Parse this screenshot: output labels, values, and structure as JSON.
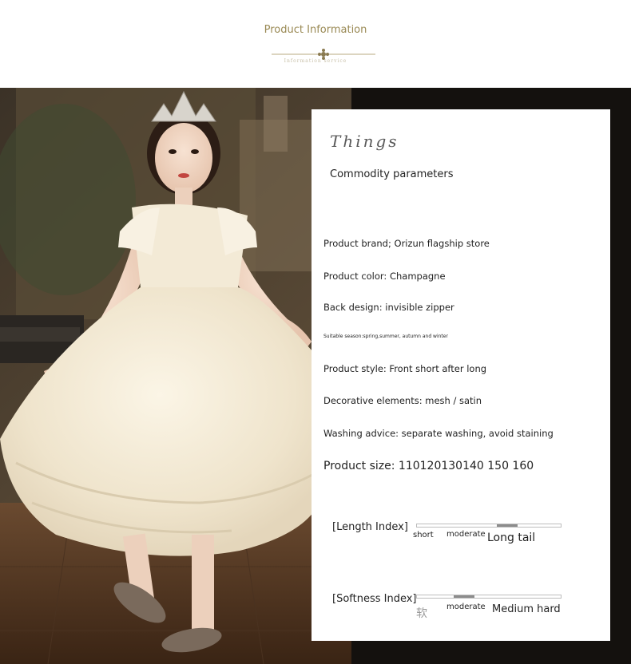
{
  "header": {
    "title": "Product Information",
    "ornament_text": "Information service"
  },
  "panel": {
    "title": "Things",
    "subtitle": "Commodity parameters",
    "params": [
      "Product brand; Orizun flagship store",
      "Product color: Champagne",
      "Back design: invisible zipper",
      "Suitable season:spring,summer, autumn and winter",
      "Product style: Front short after long",
      "Decorative elements: mesh / satin",
      "Washing advice: separate washing, avoid staining",
      "Product size: 110120130140 150 160"
    ],
    "length_index": {
      "label": "[Length Index]",
      "low": "short",
      "mid": "moderate",
      "high": "Long tail",
      "level": 0.63
    },
    "softness_index": {
      "label": "[Softness Index]",
      "low": "软",
      "mid": "moderate",
      "high": "Medium hard",
      "level": 0.33
    }
  },
  "colors": {
    "accent_gold": "#9a8a55",
    "panel_bg": "#ffffff",
    "scale_fill": "#8c8c8c"
  }
}
